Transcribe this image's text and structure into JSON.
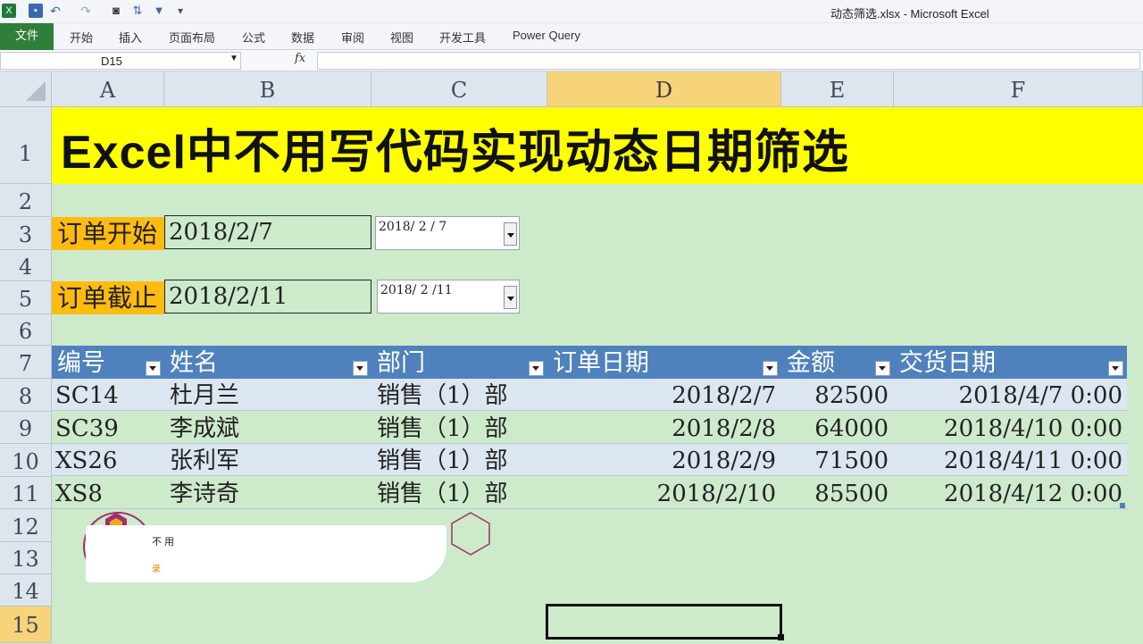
{
  "window": {
    "title": "动态筛选.xlsx - Microsoft Excel"
  },
  "ribbon": {
    "file_tab": "文件",
    "tabs": [
      "开始",
      "插入",
      "页面布局",
      "公式",
      "数据",
      "审阅",
      "视图",
      "开发工具",
      "Power Query"
    ]
  },
  "formula_bar": {
    "name_box": "D15",
    "fx": "fx",
    "formula": ""
  },
  "columns": [
    "A",
    "B",
    "C",
    "D",
    "E",
    "F"
  ],
  "rows": [
    "1",
    "2",
    "3",
    "4",
    "5",
    "6",
    "7",
    "8",
    "9",
    "10",
    "11",
    "12",
    "13",
    "14",
    "15"
  ],
  "sheet": {
    "title": "Excel中不用写代码实现动态日期筛选",
    "start": {
      "label": "订单开始",
      "value": "2018/2/7",
      "combo_value": "2018/ 2 / 7"
    },
    "end": {
      "label": "订单截止",
      "value": "2018/2/11",
      "combo_value": "2018/ 2 /11"
    },
    "table": {
      "headers": [
        "编号",
        "姓名",
        "部门",
        "订单日期",
        "金额",
        "交货日期"
      ],
      "rows": [
        [
          "SC14",
          "杜月兰",
          "销售（1）部",
          "2018/2/7",
          "82500",
          "2018/4/7  0:00"
        ],
        [
          "SC39",
          "李成斌",
          "销售（1）部",
          "2018/2/8",
          "64000",
          "2018/4/10  0:00"
        ],
        [
          "XS26",
          "张利军",
          "销售（1）部",
          "2018/2/9",
          "71500",
          "2018/4/11  0:00"
        ],
        [
          "XS8",
          "李诗奇",
          "销售（1）部",
          "2018/2/10",
          "85500",
          "2018/4/12  0:00"
        ]
      ]
    }
  },
  "overlay": {
    "line1": "不 用",
    "line2": "录"
  },
  "colors": {
    "title_fill": "#ffff00",
    "label_fill": "#ffbb10",
    "header_fill": "#4f81bd",
    "sheet_bg": "#cdeacb",
    "band_row": "#dce6f1",
    "file_tab": "#2f7f3a"
  }
}
